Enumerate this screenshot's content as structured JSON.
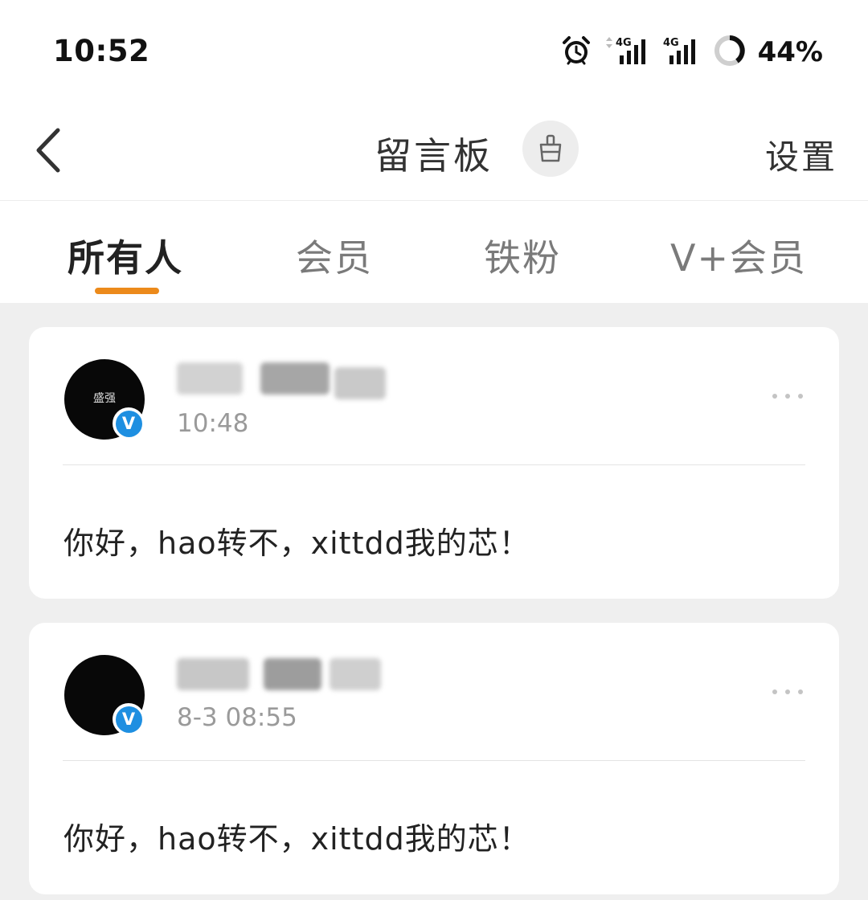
{
  "status_bar": {
    "time": "10:52",
    "battery": "44%",
    "icons": [
      "alarm-icon",
      "signal-4g-icon",
      "signal-4g-icon",
      "battery-ring-icon"
    ],
    "network_label": "4G"
  },
  "header": {
    "title": "留言板",
    "settings_label": "设置",
    "icons": [
      "back-icon",
      "broom-icon"
    ]
  },
  "tabs": [
    {
      "label": "所有人",
      "active": true
    },
    {
      "label": "会员",
      "active": false
    },
    {
      "label": "铁粉",
      "active": false
    },
    {
      "label": "V+会员",
      "active": false
    }
  ],
  "colors": {
    "accent": "#ec8a1b",
    "verified": "#1e8fe1"
  },
  "messages": [
    {
      "avatar_text": "盛强",
      "verified_badge": "V",
      "time": "10:48",
      "content": "你好，hao转不，xittdd我的芯！"
    },
    {
      "avatar_text": "",
      "verified_badge": "V",
      "time": "8-3 08:55",
      "content": "你好，hao转不，xittdd我的芯！"
    }
  ]
}
